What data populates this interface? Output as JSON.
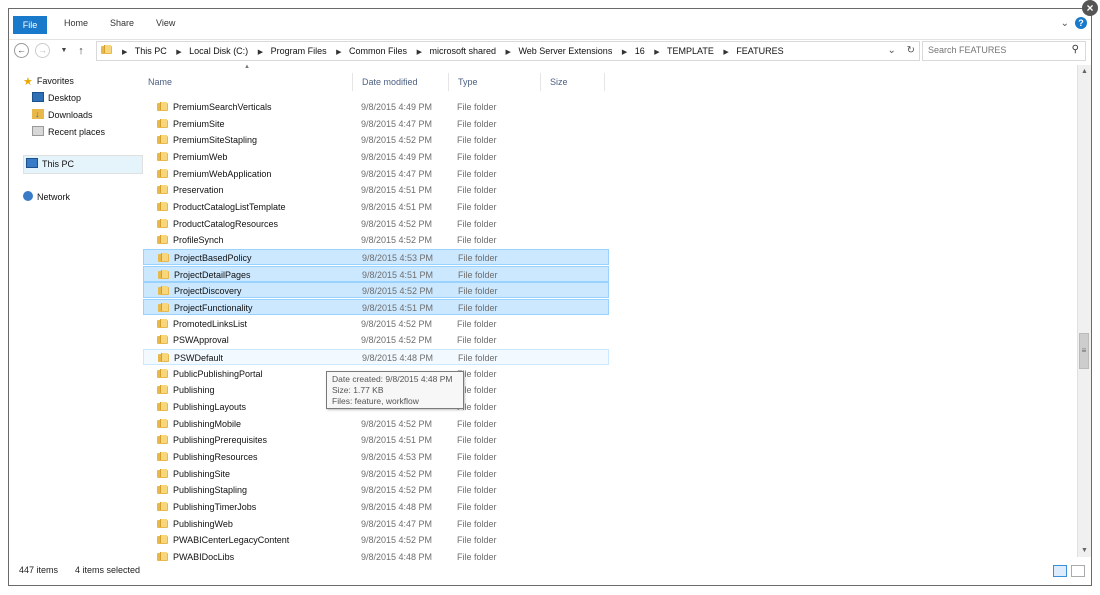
{
  "ribbon": {
    "tabs": [
      "File",
      "Home",
      "Share",
      "View"
    ]
  },
  "address": {
    "breadcrumbs": [
      "This PC",
      "Local Disk (C:)",
      "Program Files",
      "Common Files",
      "microsoft shared",
      "Web Server Extensions",
      "16",
      "TEMPLATE",
      "FEATURES"
    ],
    "search_placeholder": "Search FEATURES"
  },
  "nav": {
    "favorites": "Favorites",
    "desktop": "Desktop",
    "downloads": "Downloads",
    "recent": "Recent places",
    "this_pc": "This PC",
    "network": "Network"
  },
  "columns": {
    "name": "Name",
    "date": "Date modified",
    "type": "Type",
    "size": "Size"
  },
  "files": [
    {
      "name": "PremiumSearchVerticals",
      "date": "9/8/2015 4:49 PM",
      "type": "File folder",
      "selected": false
    },
    {
      "name": "PremiumSite",
      "date": "9/8/2015 4:47 PM",
      "type": "File folder",
      "selected": false
    },
    {
      "name": "PremiumSiteStapling",
      "date": "9/8/2015 4:52 PM",
      "type": "File folder",
      "selected": false
    },
    {
      "name": "PremiumWeb",
      "date": "9/8/2015 4:49 PM",
      "type": "File folder",
      "selected": false
    },
    {
      "name": "PremiumWebApplication",
      "date": "9/8/2015 4:47 PM",
      "type": "File folder",
      "selected": false
    },
    {
      "name": "Preservation",
      "date": "9/8/2015 4:51 PM",
      "type": "File folder",
      "selected": false
    },
    {
      "name": "ProductCatalogListTemplate",
      "date": "9/8/2015 4:51 PM",
      "type": "File folder",
      "selected": false
    },
    {
      "name": "ProductCatalogResources",
      "date": "9/8/2015 4:52 PM",
      "type": "File folder",
      "selected": false
    },
    {
      "name": "ProfileSynch",
      "date": "9/8/2015 4:52 PM",
      "type": "File folder",
      "selected": false
    },
    {
      "name": "ProjectBasedPolicy",
      "date": "9/8/2015 4:53 PM",
      "type": "File folder",
      "selected": true
    },
    {
      "name": "ProjectDetailPages",
      "date": "9/8/2015 4:51 PM",
      "type": "File folder",
      "selected": true
    },
    {
      "name": "ProjectDiscovery",
      "date": "9/8/2015 4:52 PM",
      "type": "File folder",
      "selected": true
    },
    {
      "name": "ProjectFunctionality",
      "date": "9/8/2015 4:51 PM",
      "type": "File folder",
      "selected": true
    },
    {
      "name": "PromotedLinksList",
      "date": "9/8/2015 4:52 PM",
      "type": "File folder",
      "selected": false
    },
    {
      "name": "PSWApproval",
      "date": "9/8/2015 4:52 PM",
      "type": "File folder",
      "selected": false
    },
    {
      "name": "PSWDefault",
      "date": "9/8/2015 4:48 PM",
      "type": "File folder",
      "selected": false,
      "hover": true
    },
    {
      "name": "PublicPublishingPortal",
      "date": "",
      "type": "File folder",
      "selected": false
    },
    {
      "name": "Publishing",
      "date": "",
      "type": "File folder",
      "selected": false
    },
    {
      "name": "PublishingLayouts",
      "date": "",
      "type": "File folder",
      "selected": false
    },
    {
      "name": "PublishingMobile",
      "date": "9/8/2015 4:52 PM",
      "type": "File folder",
      "selected": false
    },
    {
      "name": "PublishingPrerequisites",
      "date": "9/8/2015 4:51 PM",
      "type": "File folder",
      "selected": false
    },
    {
      "name": "PublishingResources",
      "date": "9/8/2015 4:53 PM",
      "type": "File folder",
      "selected": false
    },
    {
      "name": "PublishingSite",
      "date": "9/8/2015 4:52 PM",
      "type": "File folder",
      "selected": false
    },
    {
      "name": "PublishingStapling",
      "date": "9/8/2015 4:52 PM",
      "type": "File folder",
      "selected": false
    },
    {
      "name": "PublishingTimerJobs",
      "date": "9/8/2015 4:48 PM",
      "type": "File folder",
      "selected": false
    },
    {
      "name": "PublishingWeb",
      "date": "9/8/2015 4:47 PM",
      "type": "File folder",
      "selected": false
    },
    {
      "name": "PWABICenterLegacyContent",
      "date": "9/8/2015 4:52 PM",
      "type": "File folder",
      "selected": false
    },
    {
      "name": "PWABIDocLibs",
      "date": "9/8/2015 4:48 PM",
      "type": "File folder",
      "selected": false
    }
  ],
  "tooltip": {
    "line1": "Date created: 9/8/2015 4:48 PM",
    "line2": "Size: 1.77 KB",
    "line3": "Files: feature, workflow"
  },
  "status": {
    "items": "447 items",
    "selected": "4 items selected"
  },
  "colors": {
    "accent": "#1979ca",
    "selection": "#cce8ff",
    "selection_border": "#99d1ff"
  }
}
